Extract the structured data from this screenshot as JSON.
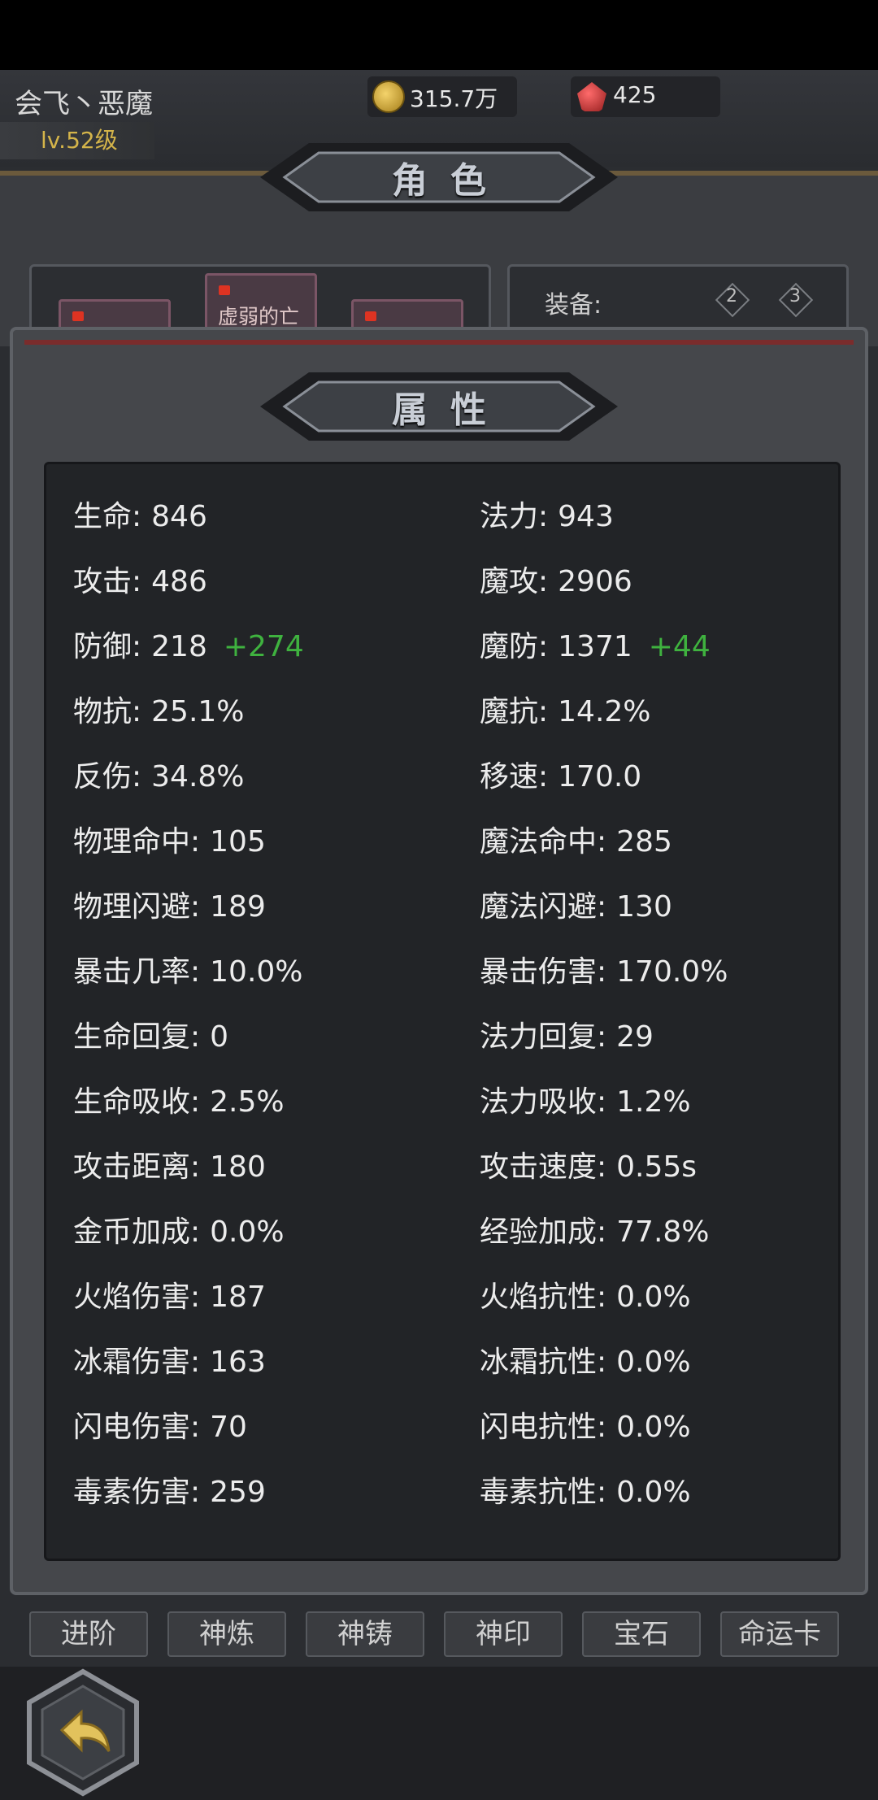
{
  "player": {
    "name": "会飞丶恶魔",
    "level": "lv.52级"
  },
  "resources": {
    "gold": "315.7万",
    "gems": "425"
  },
  "header": {
    "title": "角色"
  },
  "character": {
    "slot_label": "虚弱的亡",
    "equip_label": "装备:",
    "equip_slots": [
      "2",
      "3"
    ]
  },
  "attributes": {
    "title": "属性",
    "left": [
      {
        "label": "生命:",
        "value": "846"
      },
      {
        "label": "攻击:",
        "value": "486"
      },
      {
        "label": "防御:",
        "value": "218",
        "bonus": "+274"
      },
      {
        "label": "物抗:",
        "value": "25.1%"
      },
      {
        "label": "反伤:",
        "value": "34.8%"
      },
      {
        "label": "物理命中:",
        "value": "105"
      },
      {
        "label": "物理闪避:",
        "value": "189"
      },
      {
        "label": "暴击几率:",
        "value": "10.0%"
      },
      {
        "label": "生命回复:",
        "value": "0"
      },
      {
        "label": "生命吸收:",
        "value": "2.5%"
      },
      {
        "label": "攻击距离:",
        "value": "180"
      },
      {
        "label": "金币加成:",
        "value": "0.0%"
      },
      {
        "label": "火焰伤害:",
        "value": "187"
      },
      {
        "label": "冰霜伤害:",
        "value": "163"
      },
      {
        "label": "闪电伤害:",
        "value": "70"
      },
      {
        "label": "毒素伤害:",
        "value": "259"
      }
    ],
    "right": [
      {
        "label": "法力:",
        "value": "943"
      },
      {
        "label": "魔攻:",
        "value": "2906"
      },
      {
        "label": "魔防:",
        "value": "1371",
        "bonus": "+44"
      },
      {
        "label": "魔抗:",
        "value": "14.2%"
      },
      {
        "label": "移速:",
        "value": "170.0"
      },
      {
        "label": "魔法命中:",
        "value": "285"
      },
      {
        "label": "魔法闪避:",
        "value": "130"
      },
      {
        "label": "暴击伤害:",
        "value": "170.0%"
      },
      {
        "label": "法力回复:",
        "value": "29"
      },
      {
        "label": "法力吸收:",
        "value": "1.2%"
      },
      {
        "label": "攻击速度:",
        "value": "0.55s"
      },
      {
        "label": "经验加成:",
        "value": "77.8%"
      },
      {
        "label": "火焰抗性:",
        "value": "0.0%"
      },
      {
        "label": "冰霜抗性:",
        "value": "0.0%"
      },
      {
        "label": "闪电抗性:",
        "value": "0.0%"
      },
      {
        "label": "毒素抗性:",
        "value": "0.0%"
      }
    ]
  },
  "tabs": [
    "进阶",
    "神炼",
    "神铸",
    "神印",
    "宝石",
    "命运卡"
  ],
  "colors": {
    "bonus": "#3fb23f",
    "level": "#d4b44a"
  },
  "icons": {
    "gold": "gold-coin-icon",
    "gem": "red-gem-icon",
    "back": "back-arrow-icon"
  }
}
